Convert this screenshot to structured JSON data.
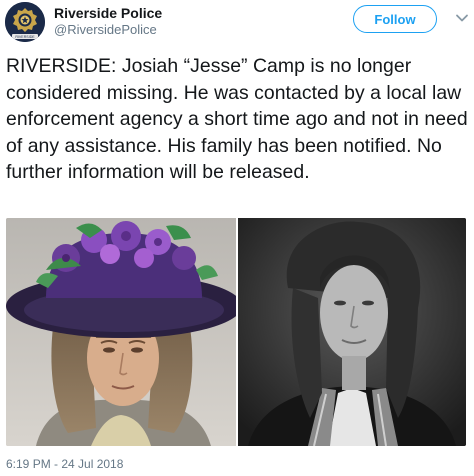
{
  "author": {
    "display_name": "Riverside Police",
    "handle": "@RiversidePolice",
    "avatar_icon": "police-badge-icon",
    "avatar_text": "RIVERSIDE"
  },
  "follow_button": {
    "label": "Follow"
  },
  "tweet": {
    "text": "RIVERSIDE:  Josiah “Jesse” Camp is no longer considered missing.  He was contacted by a local law enforcement agency a short time ago and not in need of any assistance.  His family has been notified.  No further information will be released."
  },
  "media": {
    "photos": [
      {
        "name": "photo-man-in-flowered-hat"
      },
      {
        "name": "photo-man-black-and-white"
      }
    ]
  },
  "timestamp": "6:19 PM - 24 Jul 2018",
  "colors": {
    "accent": "#1da1f2",
    "text": "#14171a",
    "secondary": "#657786"
  }
}
